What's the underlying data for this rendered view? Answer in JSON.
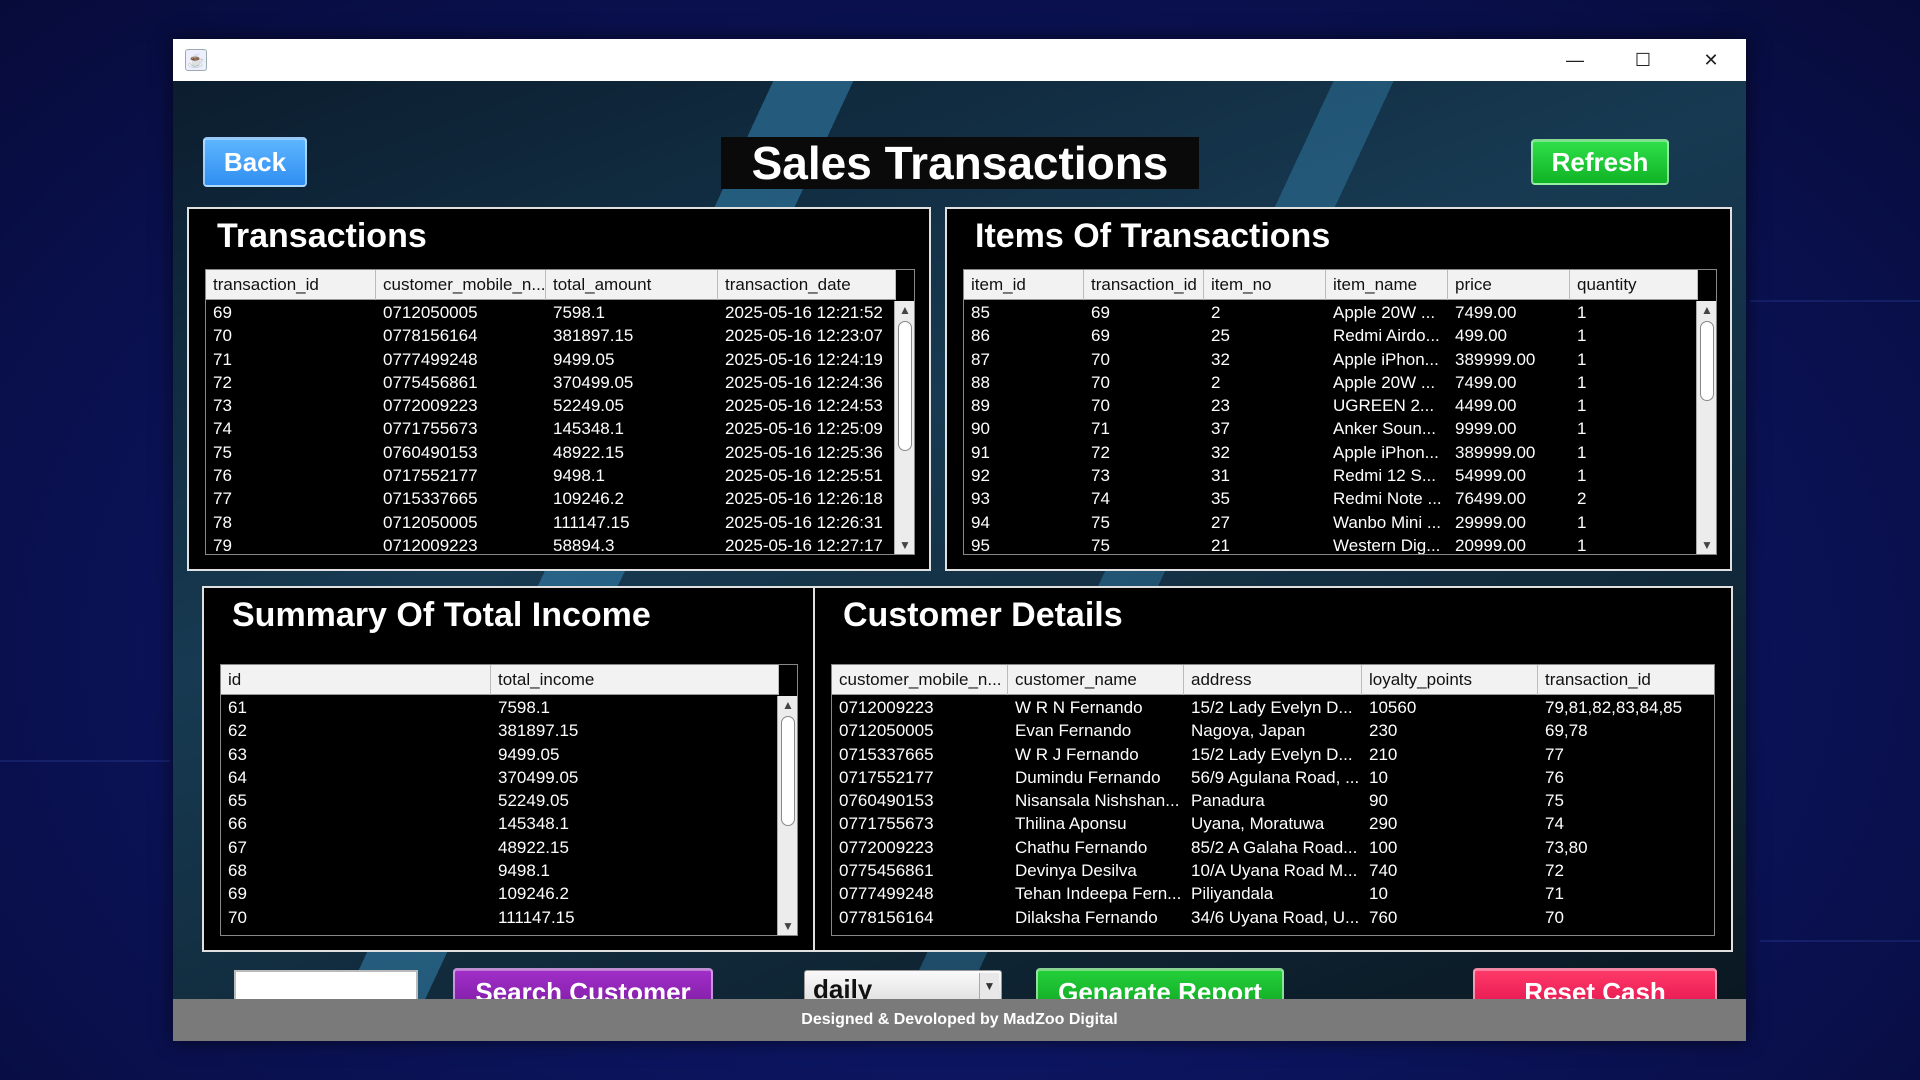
{
  "window": {
    "buttons": {
      "minimize": "—",
      "maximize": "☐",
      "close": "✕"
    }
  },
  "header": {
    "title": "Sales Transactions",
    "back_label": "Back",
    "refresh_label": "Refresh"
  },
  "transactions": {
    "title": "Transactions",
    "columns": [
      "transaction_id",
      "customer_mobile_n...",
      "total_amount",
      "transaction_date"
    ],
    "rows": [
      [
        "69",
        "0712050005",
        "7598.1",
        "2025-05-16 12:21:52"
      ],
      [
        "70",
        "0778156164",
        "381897.15",
        "2025-05-16 12:23:07"
      ],
      [
        "71",
        "0777499248",
        "9499.05",
        "2025-05-16 12:24:19"
      ],
      [
        "72",
        "0775456861",
        "370499.05",
        "2025-05-16 12:24:36"
      ],
      [
        "73",
        "0772009223",
        "52249.05",
        "2025-05-16 12:24:53"
      ],
      [
        "74",
        "0771755673",
        "145348.1",
        "2025-05-16 12:25:09"
      ],
      [
        "75",
        "0760490153",
        "48922.15",
        "2025-05-16 12:25:36"
      ],
      [
        "76",
        "0717552177",
        "9498.1",
        "2025-05-16 12:25:51"
      ],
      [
        "77",
        "0715337665",
        "109246.2",
        "2025-05-16 12:26:18"
      ],
      [
        "78",
        "0712050005",
        "111147.15",
        "2025-05-16 12:26:31"
      ],
      [
        "79",
        "0712009223",
        "58894.3",
        "2025-05-16 12:27:17"
      ]
    ]
  },
  "items": {
    "title": "Items Of Transactions",
    "columns": [
      "item_id",
      "transaction_id",
      "item_no",
      "item_name",
      "price",
      "quantity"
    ],
    "rows": [
      [
        "85",
        "69",
        "2",
        "Apple 20W ...",
        "7499.00",
        "1"
      ],
      [
        "86",
        "69",
        "25",
        "Redmi Airdo...",
        "499.00",
        "1"
      ],
      [
        "87",
        "70",
        "32",
        "Apple iPhon...",
        "389999.00",
        "1"
      ],
      [
        "88",
        "70",
        "2",
        "Apple 20W ...",
        "7499.00",
        "1"
      ],
      [
        "89",
        "70",
        "23",
        "UGREEN 2...",
        "4499.00",
        "1"
      ],
      [
        "90",
        "71",
        "37",
        "Anker Soun...",
        "9999.00",
        "1"
      ],
      [
        "91",
        "72",
        "32",
        "Apple iPhon...",
        "389999.00",
        "1"
      ],
      [
        "92",
        "73",
        "31",
        "Redmi 12 S...",
        "54999.00",
        "1"
      ],
      [
        "93",
        "74",
        "35",
        "Redmi Note ...",
        "76499.00",
        "2"
      ],
      [
        "94",
        "75",
        "27",
        "Wanbo Mini ...",
        "29999.00",
        "1"
      ],
      [
        "95",
        "75",
        "21",
        "Western Dig...",
        "20999.00",
        "1"
      ]
    ]
  },
  "summary": {
    "title": "Summary Of Total Income",
    "columns": [
      "id",
      "total_income"
    ],
    "rows": [
      [
        "61",
        "7598.1"
      ],
      [
        "62",
        "381897.15"
      ],
      [
        "63",
        "9499.05"
      ],
      [
        "64",
        "370499.05"
      ],
      [
        "65",
        "52249.05"
      ],
      [
        "66",
        "145348.1"
      ],
      [
        "67",
        "48922.15"
      ],
      [
        "68",
        "9498.1"
      ],
      [
        "69",
        "109246.2"
      ],
      [
        "70",
        "111147.15"
      ]
    ]
  },
  "customers": {
    "title": "Customer Details",
    "columns": [
      "customer_mobile_n...",
      "customer_name",
      "address",
      "loyalty_points",
      "transaction_id"
    ],
    "rows": [
      [
        "0712009223",
        "W R N Fernando",
        "15/2 Lady Evelyn D...",
        "10560",
        "79,81,82,83,84,85"
      ],
      [
        "0712050005",
        "Evan Fernando",
        "Nagoya, Japan",
        "230",
        "69,78"
      ],
      [
        "0715337665",
        "W R J Fernando",
        "15/2 Lady Evelyn D...",
        "210",
        "77"
      ],
      [
        "0717552177",
        "Dumindu Fernando",
        "56/9 Agulana Road, ...",
        "10",
        "76"
      ],
      [
        "0760490153",
        "Nisansala Nishshan...",
        "Panadura",
        "90",
        "75"
      ],
      [
        "0771755673",
        "Thilina Aponsu",
        "Uyana, Moratuwa",
        "290",
        "74"
      ],
      [
        "0772009223",
        "Chathu Fernando",
        "85/2 A Galaha Road...",
        "100",
        "73,80"
      ],
      [
        "0775456861",
        "Devinya Desilva",
        "10/A Uyana Road M...",
        "740",
        "72"
      ],
      [
        "0777499248",
        "Tehan Indeepa Fern...",
        "Piliyandala",
        "10",
        "71"
      ],
      [
        "0778156164",
        "Dilaksha Fernando",
        "34/6 Uyana Road, U...",
        "760",
        "70"
      ]
    ]
  },
  "controls": {
    "search_value": "",
    "search_label": "Search Customer",
    "period_selected": "daily",
    "report_label": "Genarate Report",
    "reset_label": "Reset Cash"
  },
  "footer": {
    "text": "Designed & Devoloped by MadZoo Digital"
  }
}
